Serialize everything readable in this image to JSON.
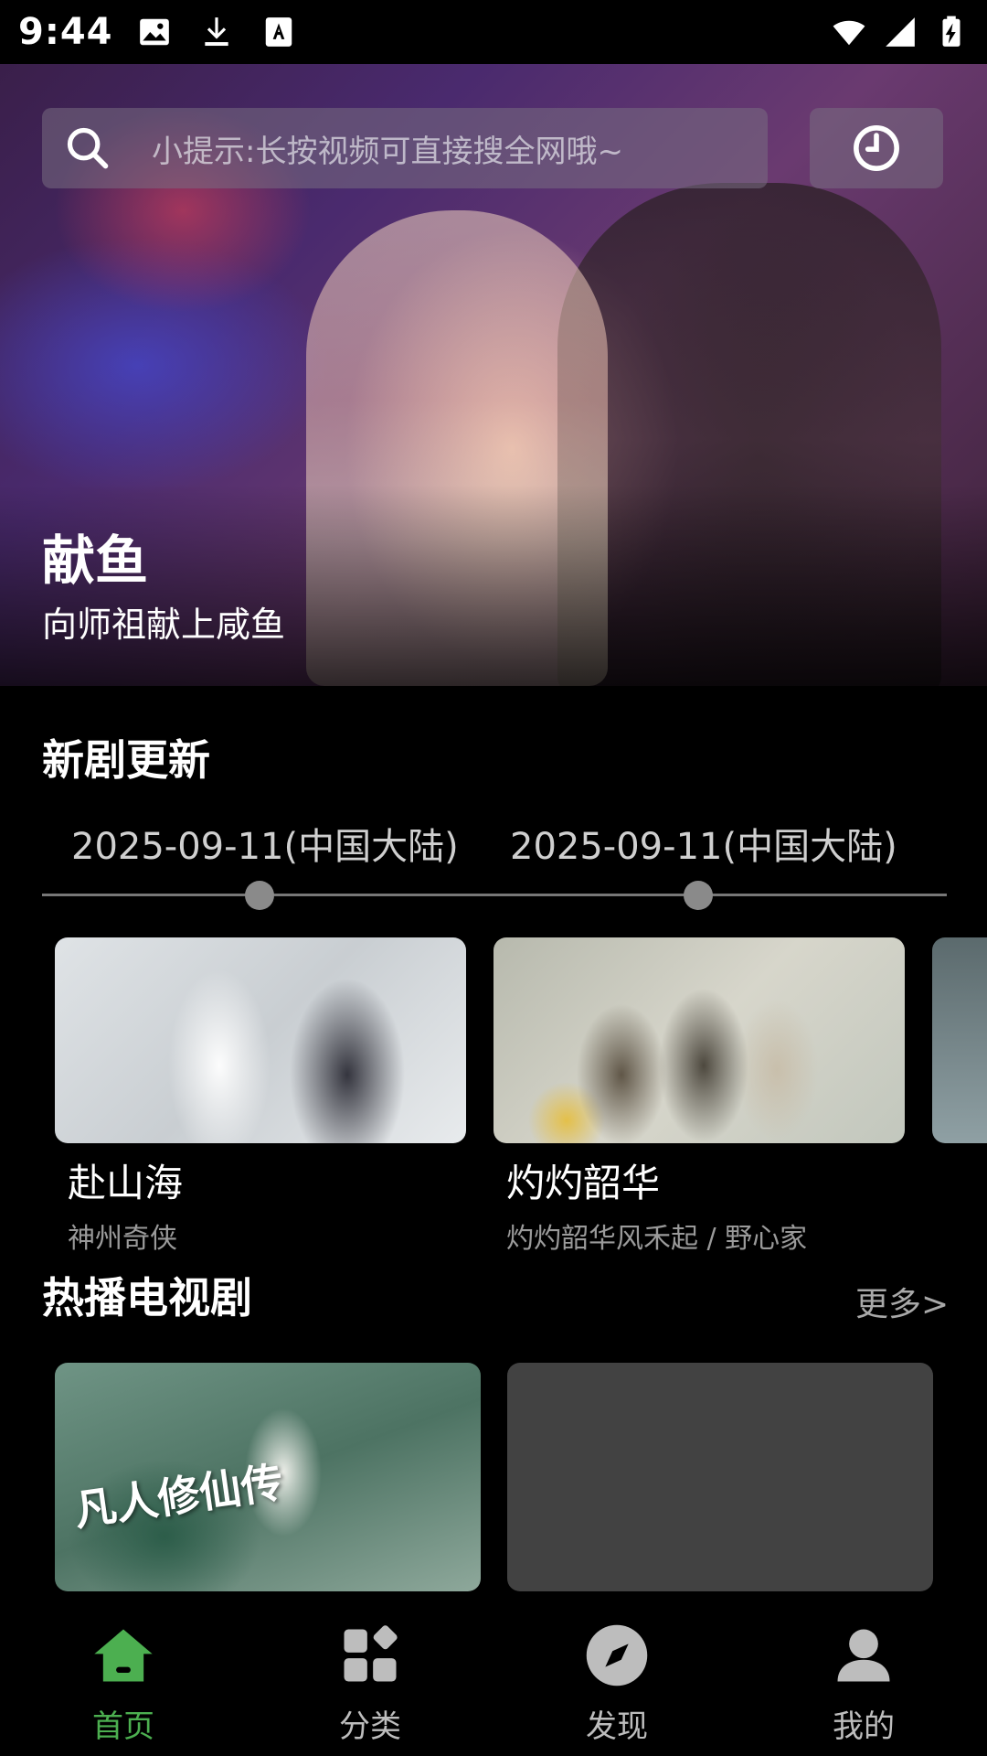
{
  "status_bar": {
    "time": "9:44",
    "left_icons": [
      "image-icon",
      "download-icon",
      "font-icon"
    ],
    "right_icons": [
      "wifi-icon",
      "signal-icon",
      "battery-charging-icon"
    ]
  },
  "hero": {
    "search_placeholder": "小提示:长按视频可直接搜全网哦~",
    "title": "献鱼",
    "subtitle": "向师祖献上咸鱼"
  },
  "new_dramas": {
    "title": "新剧更新",
    "dates": [
      "2025-09-11(中国大陆)",
      "2025-09-11(中国大陆)"
    ],
    "cards": [
      {
        "title": "赴山海",
        "subtitle": "神州奇侠"
      },
      {
        "title": "灼灼韶华",
        "subtitle": "灼灼韶华风禾起 / 野心家"
      }
    ]
  },
  "hot_tv": {
    "title": "热播电视剧",
    "more": "更多>",
    "poster_logo_text": "凡人修仙传"
  },
  "bottom_nav": {
    "items": [
      {
        "label": "首页",
        "icon": "home-icon",
        "active": true
      },
      {
        "label": "分类",
        "icon": "category-icon",
        "active": false
      },
      {
        "label": "发现",
        "icon": "compass-icon",
        "active": false
      },
      {
        "label": "我的",
        "icon": "user-icon",
        "active": false
      }
    ]
  },
  "colors": {
    "accent": "#4caf50",
    "background": "#000000"
  }
}
